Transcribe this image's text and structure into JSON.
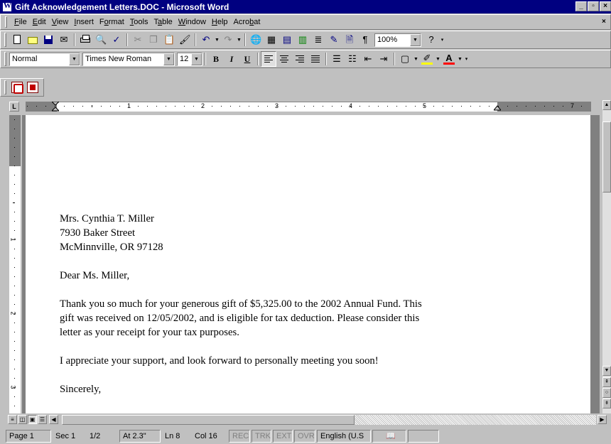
{
  "window": {
    "title": "Gift Acknowledgement Letters.DOC - Microsoft Word"
  },
  "menu": [
    {
      "key": "F",
      "rest": "ile",
      "pre": ""
    },
    {
      "key": "E",
      "rest": "dit",
      "pre": ""
    },
    {
      "key": "V",
      "rest": "iew",
      "pre": ""
    },
    {
      "key": "I",
      "rest": "nsert",
      "pre": ""
    },
    {
      "key": "o",
      "rest": "rmat",
      "pre": "F"
    },
    {
      "key": "T",
      "rest": "ools",
      "pre": ""
    },
    {
      "key": "a",
      "rest": "ble",
      "pre": "T"
    },
    {
      "key": "W",
      "rest": "indow",
      "pre": ""
    },
    {
      "key": "H",
      "rest": "elp",
      "pre": ""
    },
    {
      "key": "b",
      "rest": "at",
      "pre": "Acro"
    }
  ],
  "standard_toolbar": {
    "zoom": "100%"
  },
  "formatting_toolbar": {
    "style": "Normal",
    "font": "Times New Roman",
    "size": "12"
  },
  "ruler": {
    "numbers": [
      "1",
      "2",
      "3",
      "4",
      "5",
      "7"
    ]
  },
  "vruler": {
    "numbers": [
      "1",
      "2",
      "3"
    ]
  },
  "letter": {
    "address": [
      "Mrs. Cynthia T. Miller",
      "7930 Baker Street",
      "McMinnville, OR 97128"
    ],
    "salutation": "Dear Ms. Miller,",
    "body1": [
      "Thank you so much for your generous gift of $5,325.00 to the 2002 Annual Fund. This",
      "gift was received on 12/05/2002, and is eligible for tax deduction. Please consider this",
      "letter as your receipt for your tax purposes."
    ],
    "body2": "I appreciate your support, and look forward to personally meeting you soon!",
    "closing": "Sincerely,"
  },
  "status": {
    "page": "Page 1",
    "section": "Sec 1",
    "pages": "1/2",
    "at": "At 2.3\"",
    "line": "Ln 8",
    "col": "Col 16",
    "rec": "REC",
    "trk": "TRK",
    "ext": "EXT",
    "ovr": "OVR",
    "language": "English (U.S"
  },
  "colors": {
    "titlebar": "#000080",
    "face": "#c0c0c0",
    "highlight": "#ffff00",
    "font_color": "#ff0000"
  }
}
